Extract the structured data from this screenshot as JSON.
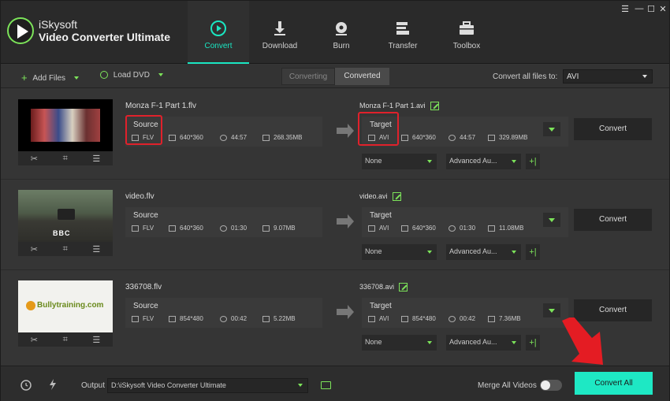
{
  "app": {
    "brand_line1": "iSkysoft",
    "brand_line2": "Video Converter Ultimate",
    "accent_color": "#1ae6c2",
    "green_color": "#7ce35a",
    "highlight_color": "#e0212b"
  },
  "window_controls": [
    "☰",
    "—",
    "☐",
    "✕"
  ],
  "nav": [
    {
      "label": "Convert",
      "icon": "convert-icon",
      "active": true
    },
    {
      "label": "Download",
      "icon": "download-icon"
    },
    {
      "label": "Burn",
      "icon": "burn-disc-icon"
    },
    {
      "label": "Transfer",
      "icon": "transfer-icon"
    },
    {
      "label": "Toolbox",
      "icon": "toolbox-icon"
    }
  ],
  "toolbar": {
    "add_files": "Add Files",
    "load_dvd": "Load DVD",
    "tab_converting": "Converting",
    "tab_converted": "Converted",
    "convert_all_label": "Convert all files to:",
    "convert_all_value": "AVI"
  },
  "files": [
    {
      "name": "Monza F-1 Part 1.flv",
      "source": {
        "label": "Source",
        "format": "FLV",
        "resolution": "640*360",
        "duration": "44:57",
        "size": "268.35MB"
      },
      "target_name": "Monza F-1 Part 1.avi",
      "target": {
        "label": "Target",
        "format": "AVI",
        "resolution": "640*360",
        "duration": "44:57",
        "size": "329.89MB"
      },
      "subtitle": "None",
      "audio": "Advanced Au...",
      "convert": "Convert"
    },
    {
      "name": "video.flv",
      "source": {
        "label": "Source",
        "format": "FLV",
        "resolution": "640*360",
        "duration": "01:30",
        "size": "9.07MB"
      },
      "target_name": "video.avi",
      "target": {
        "label": "Target",
        "format": "AVI",
        "resolution": "640*360",
        "duration": "01:30",
        "size": "11.08MB"
      },
      "subtitle": "None",
      "audio": "Advanced Au...",
      "convert": "Convert",
      "thumb_text": "BBC"
    },
    {
      "name": "336708.flv",
      "source": {
        "label": "Source",
        "format": "FLV",
        "resolution": "854*480",
        "duration": "00:42",
        "size": "5.22MB"
      },
      "target_name": "336708.avi",
      "target": {
        "label": "Target",
        "format": "AVI",
        "resolution": "854*480",
        "duration": "00:42",
        "size": "7.36MB"
      },
      "subtitle": "None",
      "audio": "Advanced Au...",
      "convert": "Convert",
      "thumb_text": "Bullytraining.com"
    }
  ],
  "bottom": {
    "output_label": "Output",
    "output_path": "D:\\iSkysoft Video Converter Ultimate",
    "merge_label": "Merge All Videos",
    "convert_all_button": "Convert All"
  }
}
